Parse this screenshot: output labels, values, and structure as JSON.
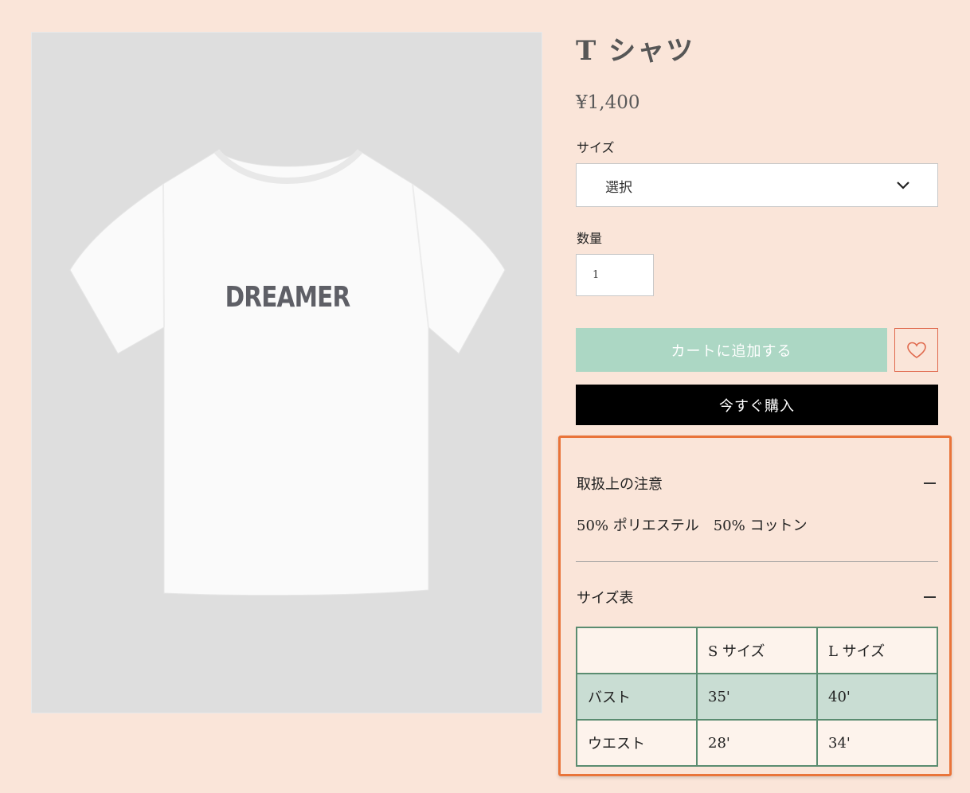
{
  "product": {
    "title": "T シャツ",
    "price": "¥1,400",
    "image_print_text": "DREAMER"
  },
  "size": {
    "label": "サイズ",
    "selected": "選択"
  },
  "quantity": {
    "label": "数量",
    "value": "1"
  },
  "actions": {
    "add_to_cart": "カートに追加する",
    "buy_now": "今すぐ購入",
    "wishlist_icon": "heart-icon"
  },
  "care": {
    "title": "取扱上の注意",
    "text": "50% ポリエステル　50% コットン"
  },
  "size_chart": {
    "title": "サイズ表",
    "headers": [
      "",
      "S サイズ",
      "L サイズ"
    ],
    "rows": [
      [
        "バスト",
        "35'",
        "40'"
      ],
      [
        "ウエスト",
        "28'",
        "34'"
      ]
    ]
  },
  "colors": {
    "page_bg": "#fae5d9",
    "add_to_cart_bg": "#acd7c4",
    "buy_now_bg": "#000000",
    "highlight": "#e9743a",
    "table_border": "#5a8c70",
    "table_row_green": "#c9ddd3"
  }
}
